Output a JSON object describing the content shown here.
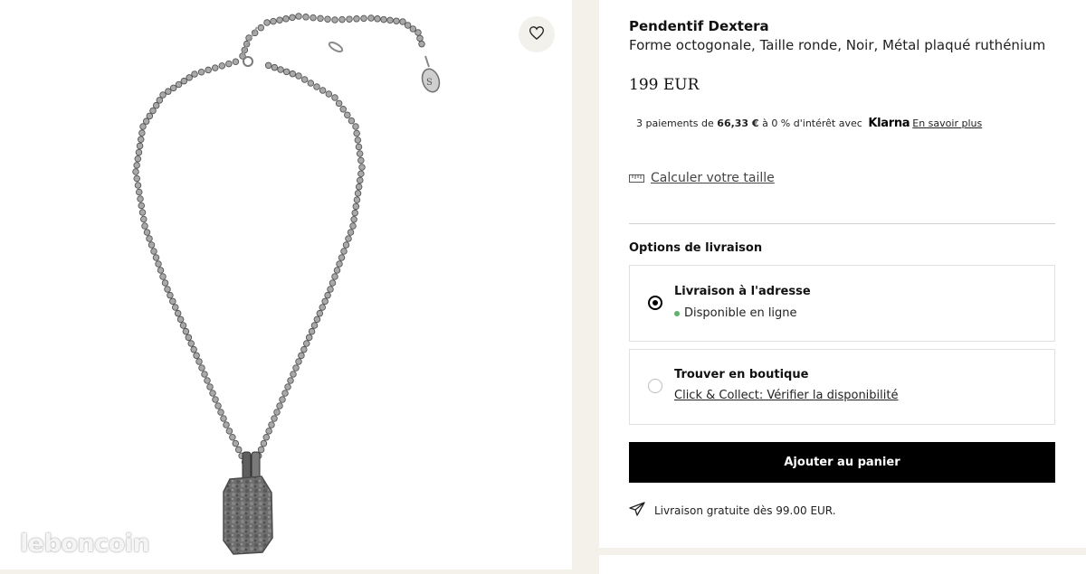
{
  "product": {
    "name": "Pendentif Dextera",
    "description": "Forme octogonale, Taille ronde, Noir, Métal plaqué ruthénium",
    "price": "199 EUR"
  },
  "klarna": {
    "prefix": "3 paiements de ",
    "amount": "66,33 €",
    "suffix": " à 0 % d'intérêt avec ",
    "brand": "Klarna",
    "link": "En savoir plus"
  },
  "size_link": "Calculer votre taille",
  "delivery": {
    "heading": "Options de livraison",
    "options": [
      {
        "title": "Livraison à l'adresse",
        "subtitle": "Disponible en ligne",
        "selected": true,
        "status_color": "#5fb36f"
      },
      {
        "title": "Trouver en boutique",
        "subtitle": "Click & Collect: Vérifier la disponibilité",
        "selected": false
      }
    ]
  },
  "add_to_cart": "Ajouter au panier",
  "shipping_note": "Livraison gratuite dès 99.00 EUR.",
  "watermark": "leboncoin",
  "icons": {
    "wishlist": "heart-icon",
    "ruler": "ruler-icon",
    "shipping": "paper-plane-icon"
  }
}
